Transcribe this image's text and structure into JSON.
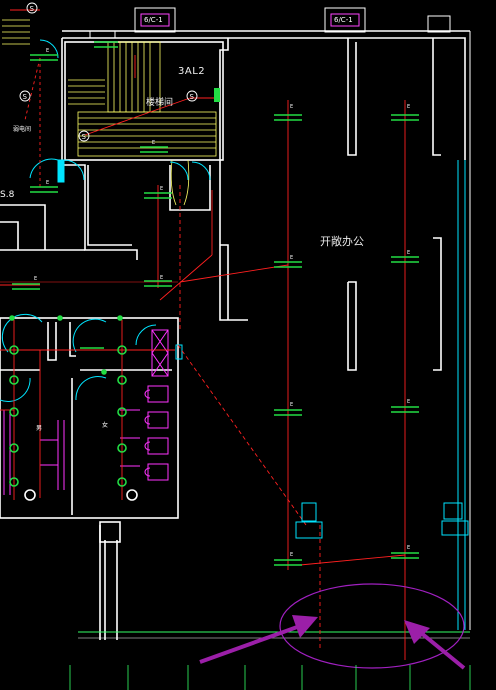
{
  "drawing": {
    "room_label": "开敞办公",
    "panel_label": "3AL2",
    "stair_label": "楼梯间",
    "side_room_label": "弱电间",
    "left_tag": "S.8",
    "top_box_labels": [
      "6/C-1",
      "6/C-1"
    ],
    "line_tag": "E",
    "outlet_symbol": "S",
    "toilet_tags": [
      "男",
      "女"
    ]
  },
  "colors": {
    "background": "#000000",
    "walls": "#ffffff",
    "wiring": "#ff2020",
    "doors": "#00e5ff",
    "fixtures": "#22dd44",
    "sanitary": "#ff33ff",
    "stair": "#ffff66",
    "annotation_arrow": "#9b1fa8",
    "ellipse": "#a020c0"
  }
}
